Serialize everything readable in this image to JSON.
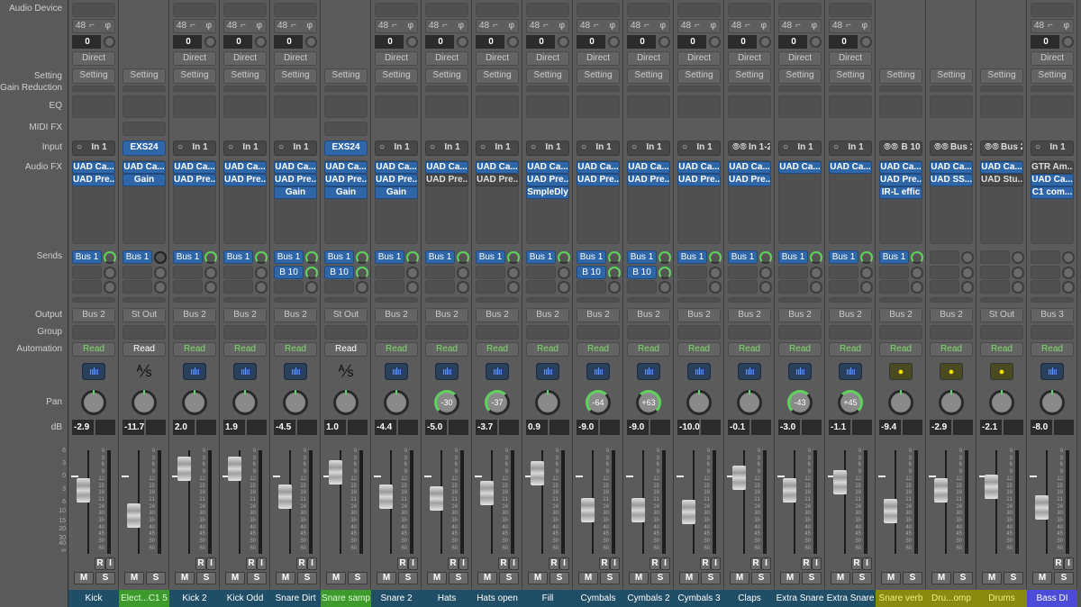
{
  "row_labels": {
    "audio_device": "Audio Device",
    "setting": "Setting",
    "gain_reduction": "Gain Reduction",
    "eq": "EQ",
    "midi_fx": "MIDI FX",
    "input": "Input",
    "audio_fx": "Audio FX",
    "sends": "Sends",
    "output": "Output",
    "group": "Group",
    "automation": "Automation",
    "pan": "Pan",
    "db": "dB"
  },
  "scale_left": [
    "6",
    "3",
    "0",
    "3",
    "6",
    "10",
    "15",
    "20",
    "30",
    "40",
    "∞"
  ],
  "scale_meter": [
    "0",
    "3",
    "6",
    "9",
    "12",
    "15",
    "18",
    "21",
    "24",
    "30",
    "35",
    "40",
    "45",
    "50",
    "60"
  ],
  "colors": {
    "audio": "#1f4e66",
    "instrument": "#3f9a2e",
    "aux": "#8a8a10",
    "bass": "#4c4cd8",
    "plugin": "#2f66a8",
    "send_knob": "#5fd35f"
  },
  "common": {
    "sample_rate": "48",
    "phase": "φ",
    "trim": "0",
    "direct": "Direct",
    "setting": "Setting",
    "read": "Read",
    "mute": "M",
    "solo": "S",
    "rec": "R",
    "input_mon": "I"
  },
  "strips": [
    {
      "name": "Kick",
      "type": "audio",
      "device": true,
      "input": "In 1",
      "input_mode": "mono",
      "fx": [
        [
          "UAD Ca...",
          1
        ],
        [
          "UAD Pre...",
          1
        ]
      ],
      "sends": [
        "Bus 1"
      ],
      "output": "Bus 2",
      "pan": 0,
      "db": "-2.9",
      "ri": true
    },
    {
      "name": "Elect...C1 5",
      "type": "instrument",
      "device": false,
      "input": "EXS24",
      "input_mode": "inst",
      "fx": [
        [
          "UAD Ca...",
          1
        ],
        [
          "Gain",
          1
        ]
      ],
      "sends": [
        "Bus 1"
      ],
      "send_off": true,
      "output": "St Out",
      "pan": 0,
      "db": "-11.7",
      "ri": false
    },
    {
      "name": "Kick 2",
      "type": "audio",
      "device": true,
      "input": "In 1",
      "input_mode": "mono",
      "fx": [
        [
          "UAD Ca...",
          1
        ],
        [
          "UAD Pre...",
          1
        ]
      ],
      "sends": [
        "Bus 1"
      ],
      "output": "Bus 2",
      "pan": 0,
      "db": "2.0",
      "ri": true
    },
    {
      "name": "Kick Odd",
      "type": "audio",
      "device": true,
      "input": "In 1",
      "input_mode": "mono",
      "fx": [
        [
          "UAD Ca...",
          1
        ],
        [
          "UAD Pre...",
          1
        ]
      ],
      "sends": [
        "Bus 1"
      ],
      "output": "Bus 2",
      "pan": 0,
      "db": "1.9",
      "ri": true
    },
    {
      "name": "Snare Dirt",
      "type": "audio",
      "device": true,
      "input": "In 1",
      "input_mode": "mono",
      "fx": [
        [
          "UAD Ca...",
          1
        ],
        [
          "UAD Pre...",
          1
        ],
        [
          "Gain",
          1
        ]
      ],
      "sends": [
        "Bus 1",
        "B 10"
      ],
      "output": "Bus 2",
      "pan": 0,
      "db": "-4.5",
      "ri": true
    },
    {
      "name": "Snare samp",
      "type": "instrument",
      "device": false,
      "input": "EXS24",
      "input_mode": "inst",
      "fx": [
        [
          "UAD Ca...",
          1
        ],
        [
          "UAD Pre...",
          1
        ],
        [
          "Gain",
          1
        ]
      ],
      "sends": [
        "Bus 1",
        "B 10"
      ],
      "output": "St Out",
      "pan": 0,
      "db": "1.0",
      "ri": false
    },
    {
      "name": "Snare 2",
      "type": "audio",
      "device": true,
      "input": "In 1",
      "input_mode": "mono",
      "fx": [
        [
          "UAD Ca...",
          1
        ],
        [
          "UAD Pre...",
          1
        ],
        [
          "Gain",
          1
        ]
      ],
      "sends": [
        "Bus 1"
      ],
      "output": "Bus 2",
      "pan": 0,
      "db": "-4.4",
      "ri": true
    },
    {
      "name": "Hats",
      "type": "audio",
      "device": true,
      "input": "In 1",
      "input_mode": "mono",
      "fx": [
        [
          "UAD Ca...",
          1
        ],
        [
          "UAD Pre...",
          0
        ]
      ],
      "sends": [
        "Bus 1"
      ],
      "output": "Bus 2",
      "pan": -30,
      "db": "-5.0",
      "ri": true
    },
    {
      "name": "Hats open",
      "type": "audio",
      "device": true,
      "input": "In 1",
      "input_mode": "mono",
      "fx": [
        [
          "UAD Ca...",
          1
        ],
        [
          "UAD Pre...",
          0
        ]
      ],
      "sends": [
        "Bus 1"
      ],
      "output": "Bus 2",
      "pan": -37,
      "db": "-3.7",
      "ri": true
    },
    {
      "name": "Fill",
      "type": "audio",
      "device": true,
      "input": "In 1",
      "input_mode": "mono",
      "fx": [
        [
          "UAD Ca...",
          1
        ],
        [
          "UAD Pre...",
          1
        ],
        [
          "SmpleDly",
          1
        ]
      ],
      "sends": [
        "Bus 1"
      ],
      "output": "Bus 2",
      "pan": 0,
      "db": "0.9",
      "ri": true
    },
    {
      "name": "Cymbals",
      "type": "audio",
      "device": true,
      "input": "In 1",
      "input_mode": "mono",
      "fx": [
        [
          "UAD Ca...",
          1
        ],
        [
          "UAD Pre...",
          1
        ]
      ],
      "sends": [
        "Bus 1",
        "B 10"
      ],
      "output": "Bus 2",
      "pan": -64,
      "db": "-9.0",
      "ri": true
    },
    {
      "name": "Cymbals 2",
      "type": "audio",
      "device": true,
      "input": "In 1",
      "input_mode": "mono",
      "fx": [
        [
          "UAD Ca...",
          1
        ],
        [
          "UAD Pre...",
          1
        ]
      ],
      "sends": [
        "Bus 1",
        "B 10"
      ],
      "output": "Bus 2",
      "pan": 63,
      "db": "-9.0",
      "ri": true
    },
    {
      "name": "Cymbals 3",
      "type": "audio",
      "device": true,
      "input": "In 1",
      "input_mode": "mono",
      "fx": [
        [
          "UAD Ca...",
          1
        ],
        [
          "UAD Pre...",
          1
        ]
      ],
      "sends": [
        "Bus 1"
      ],
      "output": "Bus 2",
      "pan": 0,
      "db": "-10.0",
      "ri": true
    },
    {
      "name": "Claps",
      "type": "audio",
      "device": true,
      "input": "In 1-2",
      "input_mode": "stereo",
      "fx": [
        [
          "UAD Ca...",
          1
        ],
        [
          "UAD Pre...",
          1
        ]
      ],
      "sends": [
        "Bus 1"
      ],
      "output": "Bus 2",
      "pan": 0,
      "db": "-0.1",
      "ri": true
    },
    {
      "name": "Extra Snare",
      "type": "audio",
      "device": true,
      "input": "In 1",
      "input_mode": "mono",
      "fx": [
        [
          "UAD Ca...",
          1
        ]
      ],
      "sends": [
        "Bus 1"
      ],
      "output": "Bus 2",
      "pan": -43,
      "db": "-3.0",
      "ri": true
    },
    {
      "name": "Extra Snare",
      "type": "audio",
      "device": true,
      "input": "In 1",
      "input_mode": "mono",
      "fx": [
        [
          "UAD Ca...",
          1
        ]
      ],
      "sends": [
        "Bus 1"
      ],
      "output": "Bus 2",
      "pan": 45,
      "db": "-1.1",
      "ri": true
    },
    {
      "name": "Snare verb",
      "type": "aux",
      "device": false,
      "input": "B 10",
      "input_mode": "stereo",
      "fx": [
        [
          "UAD Ca...",
          1
        ],
        [
          "UAD Pre...",
          1
        ],
        [
          "IR-L effic",
          1
        ]
      ],
      "sends": [
        "Bus 1"
      ],
      "output": "Bus 2",
      "pan": 0,
      "db": "-9.4",
      "ri": false
    },
    {
      "name": "Dru...omp",
      "type": "aux",
      "device": false,
      "input": "Bus 1",
      "input_mode": "stereo",
      "fx": [
        [
          "UAD Ca...",
          1
        ],
        [
          "UAD SS...",
          1
        ]
      ],
      "sends": [],
      "output": "Bus 2",
      "pan": 0,
      "db": "-2.9",
      "ri": false
    },
    {
      "name": "Drums",
      "type": "aux",
      "device": false,
      "input": "Bus 2",
      "input_mode": "stereo",
      "fx": [
        [
          "UAD Ca...",
          1
        ],
        [
          "UAD Stu...",
          0
        ]
      ],
      "sends": [],
      "output": "St Out",
      "pan": 0,
      "db": "-2.1",
      "ri": false
    },
    {
      "name": "Bass DI",
      "type": "bass",
      "device": true,
      "input": "In 1",
      "input_mode": "mono",
      "fx": [
        [
          "GTR Am...",
          0
        ],
        [
          "UAD Ca...",
          1
        ],
        [
          "C1 com...",
          1
        ]
      ],
      "sends": [],
      "output": "Bus 3",
      "pan": 0,
      "db": "-8.0",
      "ri": true
    }
  ]
}
